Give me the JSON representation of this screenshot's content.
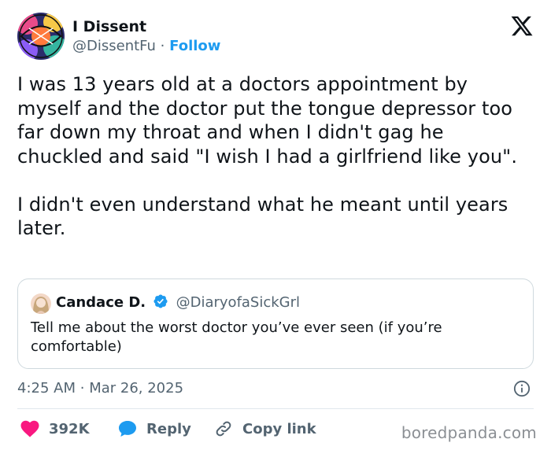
{
  "header": {
    "display_name": "I Dissent",
    "handle": "@DissentFu",
    "separator": "·",
    "follow_label": "Follow"
  },
  "tweet": {
    "text": "I was 13 years old at a doctors appointment by myself and the doctor put the tongue depressor too far down my throat and when I didn't gag he chuckled and said \"I wish I had a girlfriend like you\".\n\nI didn't even understand what he meant until years later."
  },
  "quote": {
    "display_name": "Candace D.",
    "handle": "@DiaryofaSickGrl",
    "text": "Tell me about the worst doctor you’ve ever seen (if you’re comfortable)"
  },
  "meta": {
    "time": "4:25 AM",
    "separator": "·",
    "date": "Mar 26, 2025"
  },
  "actions": {
    "like_count": "392K",
    "reply_label": "Reply",
    "copy_link_label": "Copy link"
  },
  "watermark": "boredpanda.com",
  "icons": {
    "x_logo": "x-logo-icon",
    "verified": "verified-badge-icon",
    "info": "info-icon",
    "heart": "heart-icon",
    "reply": "chat-bubble-icon",
    "link": "link-icon"
  },
  "colors": {
    "accent": "#1d9bf0",
    "like": "#f91880",
    "secondary_text": "#536471"
  }
}
